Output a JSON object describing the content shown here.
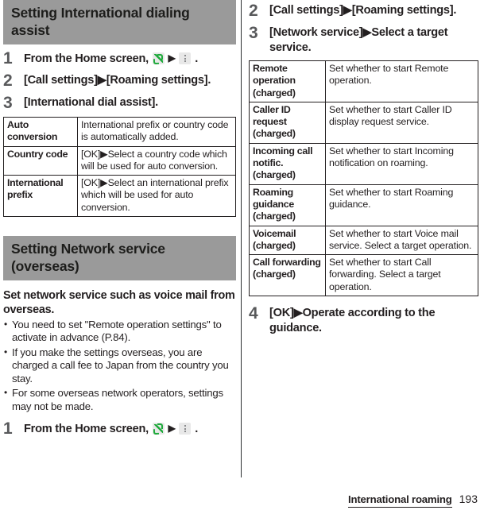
{
  "footer": {
    "chapter": "International roaming",
    "page_number": "193"
  },
  "left_column": {
    "section1": {
      "heading": "Setting International dialing assist",
      "steps": [
        {
          "num": "1",
          "text_before": "From the Home screen,",
          "icon1": "phone-icon",
          "arrow": "▶",
          "icon2": "overflow-menu-icon",
          "text_after": "."
        },
        {
          "num": "2",
          "text": "[Call settings]▶[Roaming settings]."
        },
        {
          "num": "3",
          "text": "[International dial assist]."
        }
      ],
      "table": [
        {
          "key": "Auto conversion",
          "value": "International prefix or country code is automatically added."
        },
        {
          "key": "Country code",
          "value": "[OK]▶Select a country code which will be used for auto conversion."
        },
        {
          "key": "International prefix",
          "value": "[OK]▶Select an international prefix which will be used for auto conversion."
        }
      ]
    },
    "section2": {
      "heading": "Setting Network service (overseas)",
      "intro": "Set network service such as voice mail from overseas.",
      "bullets": [
        "You need to set \"Remote operation settings\" to activate in advance (P.84).",
        "If you make the settings overseas, you are charged a call fee to Japan from the country you stay.",
        "For some overseas network operators, settings may not be made."
      ],
      "steps": [
        {
          "num": "1",
          "text_before": "From the Home screen,",
          "icon1": "phone-icon",
          "arrow": "▶",
          "icon2": "overflow-menu-icon",
          "text_after": "."
        }
      ]
    }
  },
  "right_column": {
    "steps_top": [
      {
        "num": "2",
        "text": "[Call settings]▶[Roaming settings]."
      },
      {
        "num": "3",
        "text": "[Network service]▶Select a target service."
      }
    ],
    "table": [
      {
        "key": "Remote operation (charged)",
        "value": "Set whether to start Remote operation."
      },
      {
        "key": "Caller ID request (charged)",
        "value": "Set whether to start Caller ID display request service."
      },
      {
        "key": "Incoming call notific. (charged)",
        "value": "Set whether to start Incoming notification on roaming."
      },
      {
        "key": "Roaming guidance (charged)",
        "value": "Set whether to start Roaming guidance."
      },
      {
        "key": "Voicemail (charged)",
        "value": "Set whether to start Voice mail service.\nSelect a target operation."
      },
      {
        "key": "Call forwarding (charged)",
        "value": "Set whether to start Call forwarding.\nSelect a target operation."
      }
    ],
    "steps_bottom": [
      {
        "num": "4",
        "text": "[OK]▶Operate according to the guidance."
      }
    ]
  }
}
